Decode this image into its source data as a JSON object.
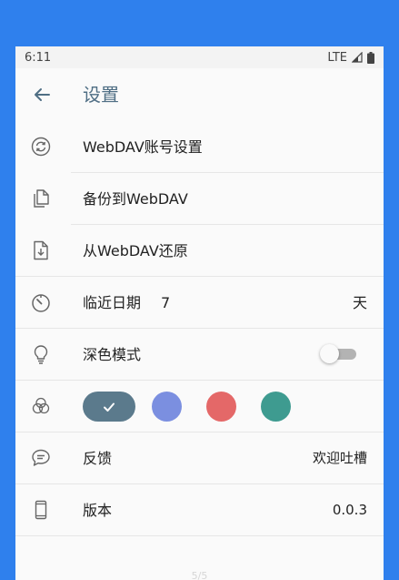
{
  "status_bar": {
    "time": "6:11",
    "network": "LTE"
  },
  "app_bar": {
    "title": "设置"
  },
  "settings": {
    "webdav_account": {
      "label": "WebDAV账号设置",
      "icon": "sync-icon"
    },
    "backup": {
      "label": "备份到WebDAV",
      "icon": "copy-icon"
    },
    "restore": {
      "label": "从WebDAV还原",
      "icon": "file-download-icon"
    },
    "recent_days": {
      "label": "临近日期",
      "value": "7",
      "unit": "天",
      "icon": "timer-icon"
    },
    "dark_mode": {
      "label": "深色模式",
      "enabled": false,
      "icon": "lightbulb-icon"
    },
    "theme": {
      "icon": "color-circles-icon",
      "colors": [
        "#5b7a8c",
        "#7b8fe0",
        "#e46868",
        "#3e9b90"
      ],
      "selected_index": 0
    },
    "feedback": {
      "label": "反馈",
      "value": "欢迎吐槽",
      "icon": "chat-icon"
    },
    "version": {
      "label": "版本",
      "value": "0.0.3",
      "icon": "phone-icon"
    }
  },
  "footer": {
    "page_indicator": "5/5"
  },
  "colors": {
    "background": "#2f80ed",
    "accent": "#4f6e84",
    "icon_gray": "#666666"
  }
}
